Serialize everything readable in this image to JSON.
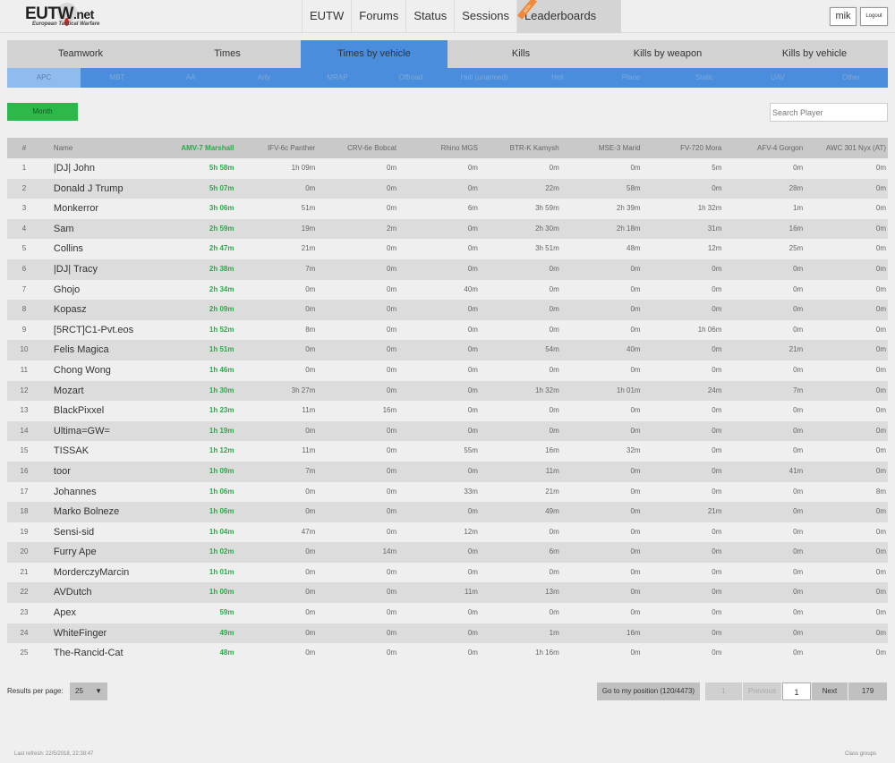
{
  "logo": {
    "main": "EUTW",
    "suffix": ".net",
    "subtitle": "European Tactical Warfare"
  },
  "nav": {
    "items": [
      {
        "label": "EUTW"
      },
      {
        "label": "Forums"
      },
      {
        "label": "Status"
      },
      {
        "label": "Sessions"
      },
      {
        "label": "Leaderboards",
        "active": true,
        "ribbon": "BETA"
      }
    ]
  },
  "user": {
    "name": "mik",
    "logout_label": "Logout"
  },
  "tabs": [
    {
      "label": "Teamwork"
    },
    {
      "label": "Times"
    },
    {
      "label": "Times by vehicle",
      "active": true
    },
    {
      "label": "Kills"
    },
    {
      "label": "Kills by weapon"
    },
    {
      "label": "Kills by vehicle"
    }
  ],
  "subtabs": [
    {
      "label": "APC",
      "active": true
    },
    {
      "label": "MBT"
    },
    {
      "label": "AA"
    },
    {
      "label": "Arty"
    },
    {
      "label": "MRAP"
    },
    {
      "label": "Offroad"
    },
    {
      "label": "Heli (unarmed)"
    },
    {
      "label": "Heli"
    },
    {
      "label": "Plane"
    },
    {
      "label": "Static"
    },
    {
      "label": "UAV"
    },
    {
      "label": "Other"
    }
  ],
  "filter": {
    "period_label": "Month"
  },
  "search": {
    "placeholder": "Search Player",
    "value": ""
  },
  "colors": {
    "accent_blue": "#4a8ddc",
    "active_subtab": "#8fbbee",
    "green": "#2db84b",
    "highlight_text": "#2da84a"
  },
  "table": {
    "columns": [
      "#",
      "Name",
      "AMV-7 Marshall",
      "IFV-6c Panther",
      "CRV-6e Bobcat",
      "Rhino MGS",
      "BTR-K Kamysh",
      "MSE-3 Marid",
      "FV-720 Mora",
      "AFV-4 Gorgon",
      "AWC 301 Nyx (AT)"
    ],
    "sorted_column": "AMV-7 Marshall",
    "rows": [
      {
        "rank": "1",
        "name": "|DJ| John",
        "values": [
          "5h 58m",
          "1h 09m",
          "0m",
          "0m",
          "0m",
          "0m",
          "5m",
          "0m",
          "0m"
        ]
      },
      {
        "rank": "2",
        "name": "Donald J Trump",
        "values": [
          "5h 07m",
          "0m",
          "0m",
          "0m",
          "22m",
          "58m",
          "0m",
          "28m",
          "0m"
        ]
      },
      {
        "rank": "3",
        "name": "Monkerror",
        "values": [
          "3h 06m",
          "51m",
          "0m",
          "6m",
          "3h 59m",
          "2h 39m",
          "1h 32m",
          "1m",
          "0m"
        ]
      },
      {
        "rank": "4",
        "name": "Sam",
        "values": [
          "2h 59m",
          "19m",
          "2m",
          "0m",
          "2h 30m",
          "2h 18m",
          "31m",
          "16m",
          "0m"
        ]
      },
      {
        "rank": "5",
        "name": "Collins",
        "values": [
          "2h 47m",
          "21m",
          "0m",
          "0m",
          "3h 51m",
          "48m",
          "12m",
          "25m",
          "0m"
        ]
      },
      {
        "rank": "6",
        "name": "|DJ| Tracy",
        "values": [
          "2h 38m",
          "7m",
          "0m",
          "0m",
          "0m",
          "0m",
          "0m",
          "0m",
          "0m"
        ]
      },
      {
        "rank": "7",
        "name": "Ghojo",
        "values": [
          "2h 34m",
          "0m",
          "0m",
          "40m",
          "0m",
          "0m",
          "0m",
          "0m",
          "0m"
        ]
      },
      {
        "rank": "8",
        "name": "Kopasz",
        "values": [
          "2h 09m",
          "0m",
          "0m",
          "0m",
          "0m",
          "0m",
          "0m",
          "0m",
          "0m"
        ]
      },
      {
        "rank": "9",
        "name": "[5RCT]C1-Pvt.eos",
        "values": [
          "1h 52m",
          "8m",
          "0m",
          "0m",
          "0m",
          "0m",
          "1h 06m",
          "0m",
          "0m"
        ]
      },
      {
        "rank": "10",
        "name": "Felis Magica",
        "values": [
          "1h 51m",
          "0m",
          "0m",
          "0m",
          "54m",
          "40m",
          "0m",
          "21m",
          "0m"
        ]
      },
      {
        "rank": "11",
        "name": "Chong Wong",
        "values": [
          "1h 46m",
          "0m",
          "0m",
          "0m",
          "0m",
          "0m",
          "0m",
          "0m",
          "0m"
        ]
      },
      {
        "rank": "12",
        "name": "Mozart",
        "values": [
          "1h 30m",
          "3h 27m",
          "0m",
          "0m",
          "1h 32m",
          "1h 01m",
          "24m",
          "7m",
          "0m"
        ]
      },
      {
        "rank": "13",
        "name": "BlackPixxel",
        "values": [
          "1h 23m",
          "11m",
          "16m",
          "0m",
          "0m",
          "0m",
          "0m",
          "0m",
          "0m"
        ]
      },
      {
        "rank": "14",
        "name": "Ultima=GW=",
        "values": [
          "1h 19m",
          "0m",
          "0m",
          "0m",
          "0m",
          "0m",
          "0m",
          "0m",
          "0m"
        ]
      },
      {
        "rank": "15",
        "name": "TISSAK",
        "values": [
          "1h 12m",
          "11m",
          "0m",
          "55m",
          "16m",
          "32m",
          "0m",
          "0m",
          "0m"
        ]
      },
      {
        "rank": "16",
        "name": "toor",
        "values": [
          "1h 09m",
          "7m",
          "0m",
          "0m",
          "11m",
          "0m",
          "0m",
          "41m",
          "0m"
        ]
      },
      {
        "rank": "17",
        "name": "Johannes",
        "values": [
          "1h 06m",
          "0m",
          "0m",
          "33m",
          "21m",
          "0m",
          "0m",
          "0m",
          "8m"
        ]
      },
      {
        "rank": "18",
        "name": "Marko Bolneze",
        "values": [
          "1h 06m",
          "0m",
          "0m",
          "0m",
          "49m",
          "0m",
          "21m",
          "0m",
          "0m"
        ]
      },
      {
        "rank": "19",
        "name": "Sensi-sid",
        "values": [
          "1h 04m",
          "47m",
          "0m",
          "12m",
          "0m",
          "0m",
          "0m",
          "0m",
          "0m"
        ]
      },
      {
        "rank": "20",
        "name": "Furry Ape",
        "values": [
          "1h 02m",
          "0m",
          "14m",
          "0m",
          "6m",
          "0m",
          "0m",
          "0m",
          "0m"
        ]
      },
      {
        "rank": "21",
        "name": "MorderczyMarcin",
        "values": [
          "1h 01m",
          "0m",
          "0m",
          "0m",
          "0m",
          "0m",
          "0m",
          "0m",
          "0m"
        ]
      },
      {
        "rank": "22",
        "name": "AVDutch",
        "values": [
          "1h 00m",
          "0m",
          "0m",
          "11m",
          "13m",
          "0m",
          "0m",
          "0m",
          "0m"
        ]
      },
      {
        "rank": "23",
        "name": "Apex",
        "values": [
          "59m",
          "0m",
          "0m",
          "0m",
          "0m",
          "0m",
          "0m",
          "0m",
          "0m"
        ]
      },
      {
        "rank": "24",
        "name": "WhiteFinger",
        "values": [
          "49m",
          "0m",
          "0m",
          "0m",
          "1m",
          "16m",
          "0m",
          "0m",
          "0m"
        ]
      },
      {
        "rank": "25",
        "name": "The-Rancid-Cat",
        "values": [
          "48m",
          "0m",
          "0m",
          "0m",
          "1h 16m",
          "0m",
          "0m",
          "0m",
          "0m"
        ]
      }
    ]
  },
  "results_per_page": {
    "label": "Results per page:",
    "value": "25"
  },
  "goto_position": {
    "label": "Go to my position (120/4473)"
  },
  "pagination": {
    "first": "1",
    "previous": "Previous",
    "current": "1",
    "next": "Next",
    "last": "179"
  },
  "footer": {
    "last_refresh": "Last refresh: 22/5/2018, 22:38:47",
    "right_link": "Class groups"
  }
}
